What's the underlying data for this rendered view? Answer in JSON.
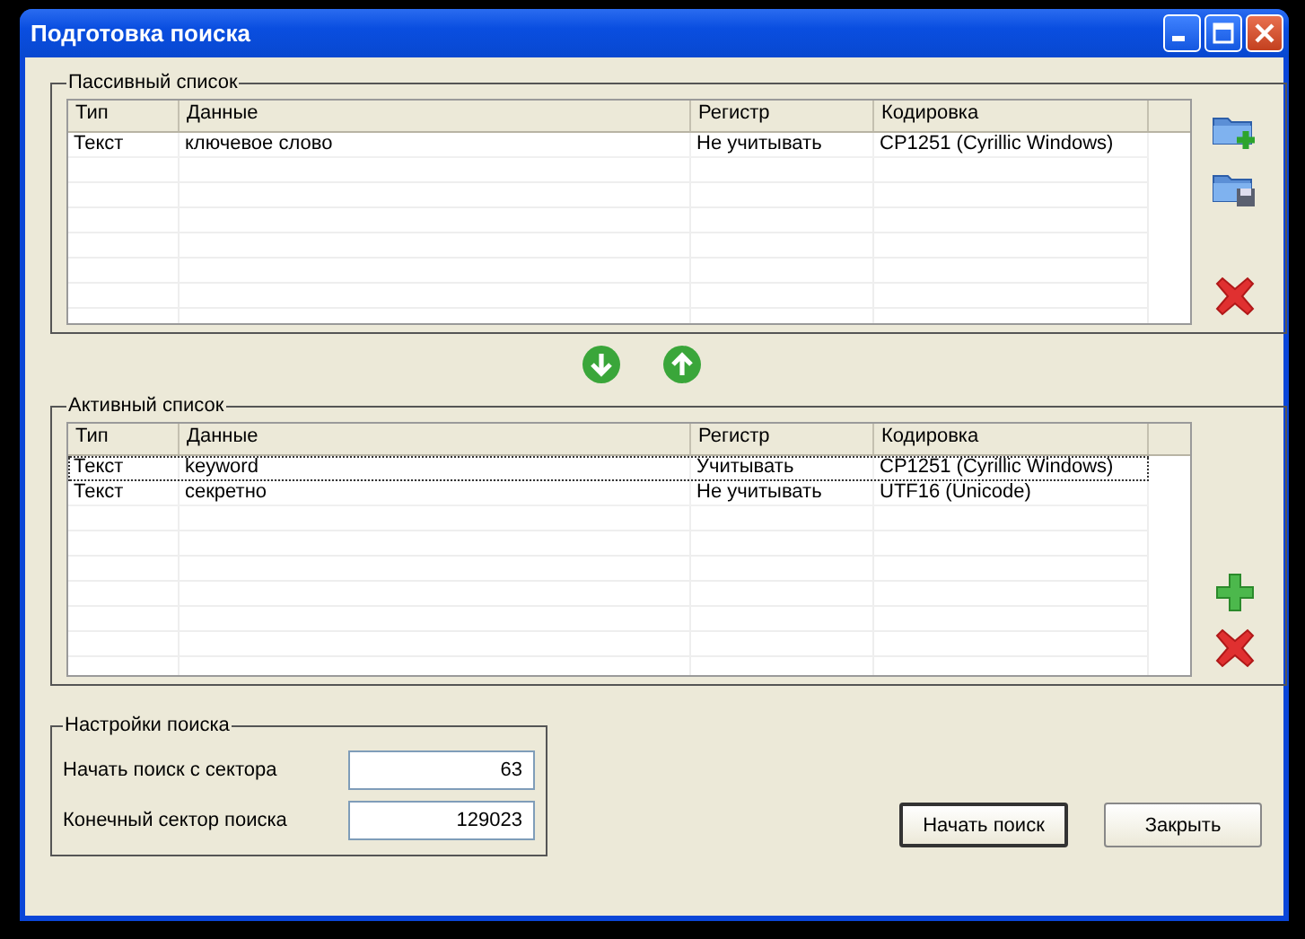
{
  "window": {
    "title": "Подготовка поиска"
  },
  "passive_list": {
    "title": "Пассивный список",
    "columns": [
      "Тип",
      "Данные",
      "Регистр",
      "Кодировка"
    ],
    "rows": [
      {
        "cells": [
          "Текст",
          "ключевое слово",
          "Не учитывать",
          "CP1251 (Cyrillic Windows)"
        ],
        "selected": false
      }
    ]
  },
  "active_list": {
    "title": "Активный список",
    "columns": [
      "Тип",
      "Данные",
      "Регистр",
      "Кодировка"
    ],
    "rows": [
      {
        "cells": [
          "Текст",
          "keyword",
          "Учитывать",
          "CP1251 (Cyrillic Windows)"
        ],
        "selected": true
      },
      {
        "cells": [
          "Текст",
          "секретно",
          "Не учитывать",
          "UTF16 (Unicode)"
        ],
        "selected": false
      }
    ]
  },
  "search_settings": {
    "title": "Настройки поиска",
    "fields": [
      {
        "label": "Начать поиск с сектора",
        "value": "63"
      },
      {
        "label": "Конечный сектор поиска",
        "value": "129023"
      }
    ]
  },
  "buttons": [
    "Начать поиск",
    "Закрыть"
  ]
}
